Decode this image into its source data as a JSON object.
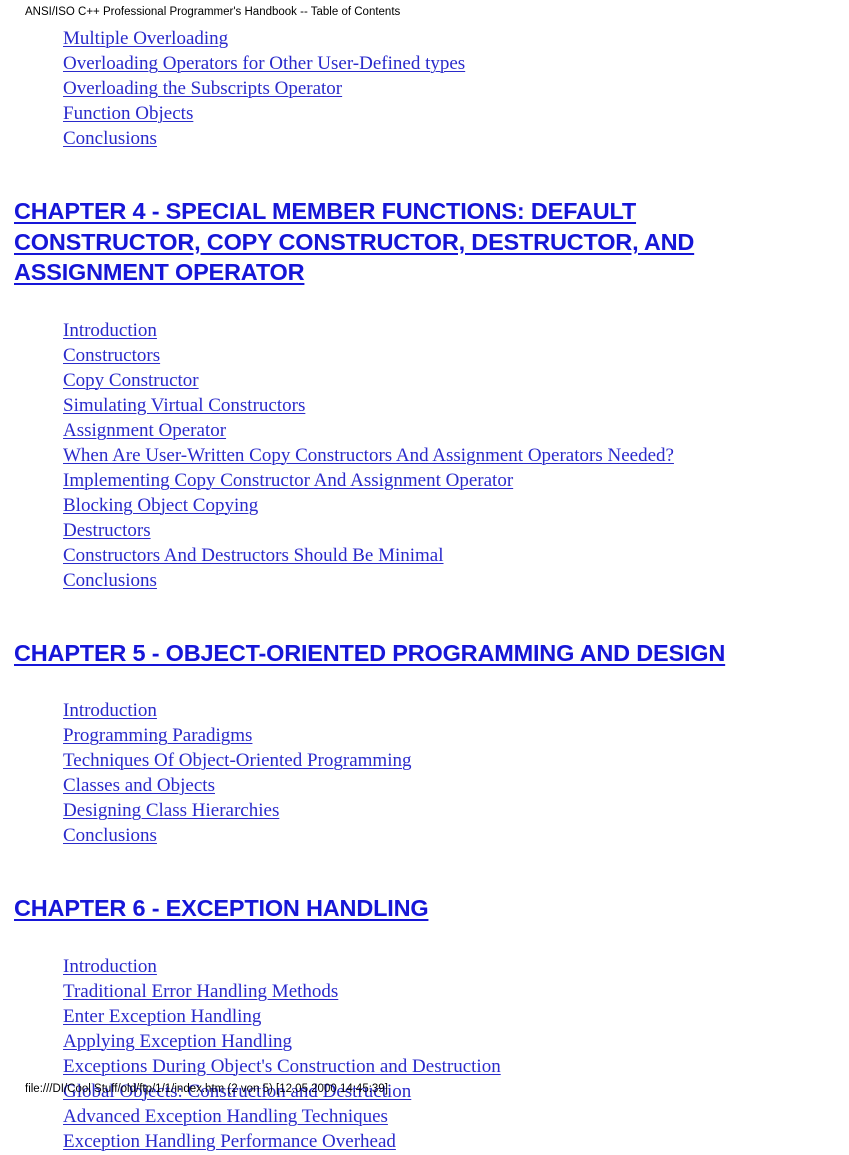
{
  "document": {
    "running_header": "ANSI/ISO C++ Professional Programmer's Handbook -- Table of Contents",
    "footer": "file:///DI/Cool Stuff/old/ftp/1/1/index.htm (2 von 5) [12.05.2000 14:45:39]",
    "link_color": "#2A2ACB",
    "heading_color": "#1616D8",
    "background_color": "#FFFFFF",
    "text_color": "#000000"
  },
  "continued_section": {
    "links": [
      "Multiple Overloading",
      "Overloading Operators for Other User-Defined types",
      "Overloading the Subscripts Operator",
      "Function Objects",
      "Conclusions"
    ]
  },
  "chapters": [
    {
      "heading": "CHAPTER 4 - SPECIAL MEMBER FUNCTIONS: DEFAULT CONSTRUCTOR, COPY CONSTRUCTOR, DESTRUCTOR, AND ASSIGNMENT OPERATOR",
      "links": [
        "Introduction",
        "Constructors",
        "Copy Constructor",
        "Simulating Virtual Constructors",
        "Assignment Operator",
        "When Are User-Written Copy Constructors And Assignment Operators Needed?",
        "Implementing Copy Constructor And Assignment Operator",
        "Blocking Object Copying",
        "Destructors",
        "Constructors And Destructors Should Be Minimal",
        "Conclusions"
      ]
    },
    {
      "heading": "CHAPTER 5 - OBJECT-ORIENTED PROGRAMMING AND DESIGN",
      "links": [
        "Introduction",
        "Programming Paradigms",
        "Techniques Of Object-Oriented Programming",
        "Classes and Objects",
        "Designing Class Hierarchies",
        "Conclusions"
      ]
    },
    {
      "heading": "CHAPTER 6 - EXCEPTION HANDLING",
      "links": [
        "Introduction",
        "Traditional Error Handling Methods",
        "Enter Exception Handling",
        "Applying Exception Handling",
        "Exceptions During Object's Construction and Destruction",
        "Global Objects: Construction and Destruction",
        "Advanced Exception Handling Techniques",
        "Exception Handling Performance Overhead"
      ]
    }
  ]
}
